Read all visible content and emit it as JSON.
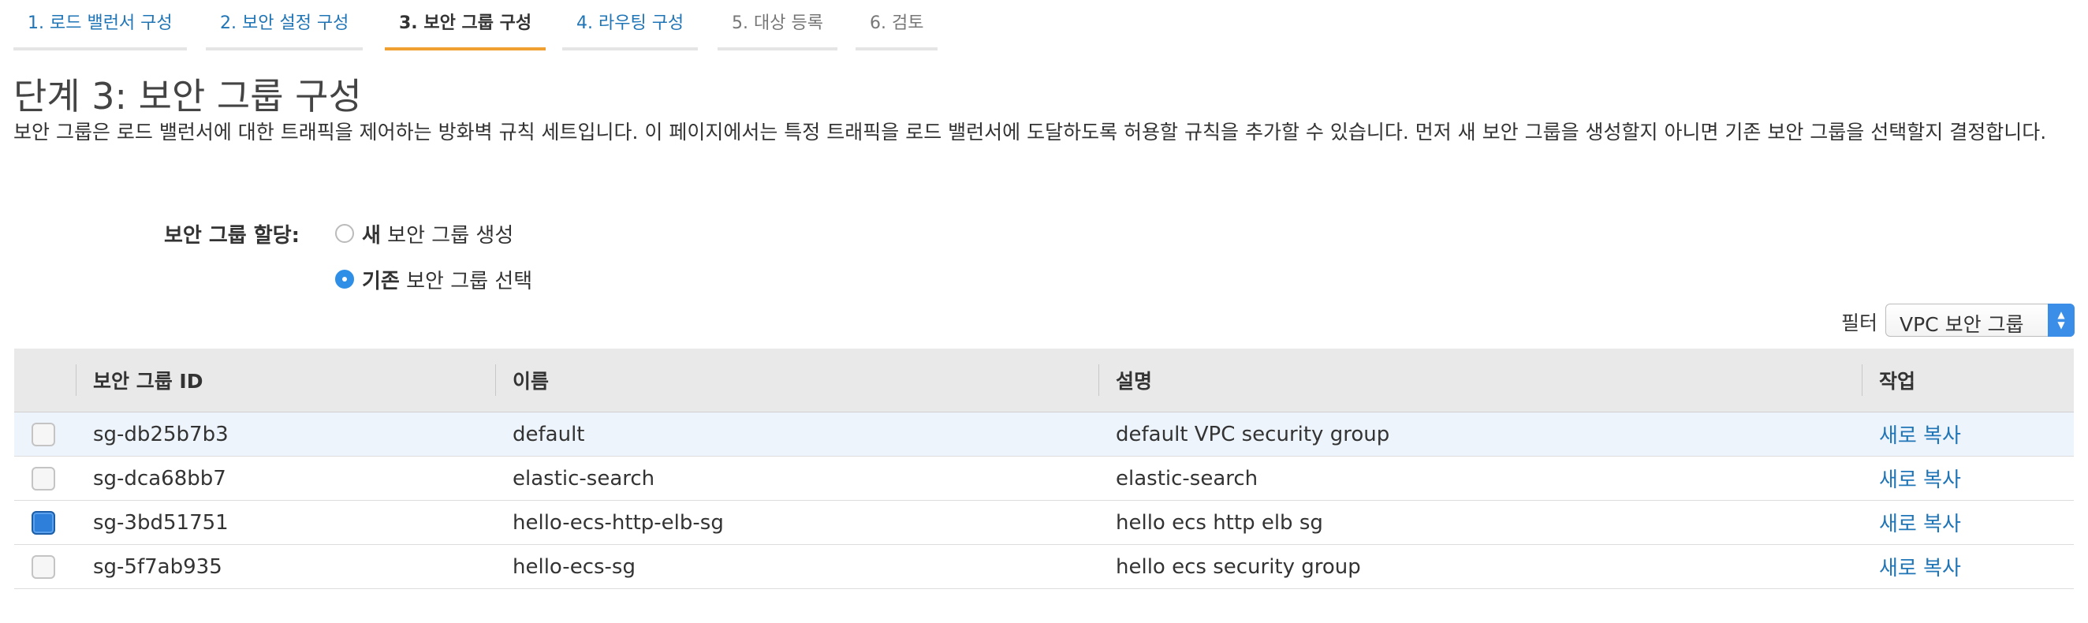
{
  "wizard": {
    "tabs": [
      {
        "label": "1. 로드 밸런서 구성",
        "state": "done"
      },
      {
        "label": "2. 보안 설정 구성",
        "state": "done"
      },
      {
        "label": "3. 보안 그룹 구성",
        "state": "active"
      },
      {
        "label": "4. 라우팅 구성",
        "state": "done"
      },
      {
        "label": "5. 대상 등록",
        "state": "future"
      },
      {
        "label": "6. 검토",
        "state": "future"
      }
    ]
  },
  "page": {
    "title": "단계 3: 보안 그룹 구성",
    "description": "보안 그룹은 로드 밸런서에 대한 트래픽을 제어하는 방화벽 규칙 세트입니다. 이 페이지에서는 특정 트래픽을 로드 밸런서에 도달하도록 허용할 규칙을 추가할 수 있습니다. 먼저 새 보안 그룹을 생성할지 아니면 기존 보안 그룹을 선택할지 결정합니다."
  },
  "assign": {
    "label": "보안 그룹 할당:",
    "option_new_bold": "새",
    "option_new_rest": " 보안 그룹 생성",
    "option_existing_bold": "기존",
    "option_existing_rest": " 보안 그룹 선택",
    "selected": "existing"
  },
  "filter": {
    "label": "필터",
    "selected": "VPC 보안 그룹"
  },
  "table": {
    "headers": {
      "id": "보안 그룹 ID",
      "name": "이름",
      "description": "설명",
      "actions": "작업"
    },
    "rows": [
      {
        "checked": false,
        "id": "sg-db25b7b3",
        "name": "default",
        "description": "default VPC security group",
        "action": "새로 복사"
      },
      {
        "checked": false,
        "id": "sg-dca68bb7",
        "name": "elastic-search",
        "description": "elastic-search",
        "action": "새로 복사"
      },
      {
        "checked": true,
        "id": "sg-3bd51751",
        "name": "hello-ecs-http-elb-sg",
        "description": "hello ecs http elb sg",
        "action": "새로 복사"
      },
      {
        "checked": false,
        "id": "sg-5f7ab935",
        "name": "hello-ecs-sg",
        "description": "hello ecs security group",
        "action": "새로 복사"
      }
    ]
  },
  "colors": {
    "link": "#2075b6",
    "active_tab_underline": "#f0a030",
    "selected_control": "#2f8fe6"
  }
}
